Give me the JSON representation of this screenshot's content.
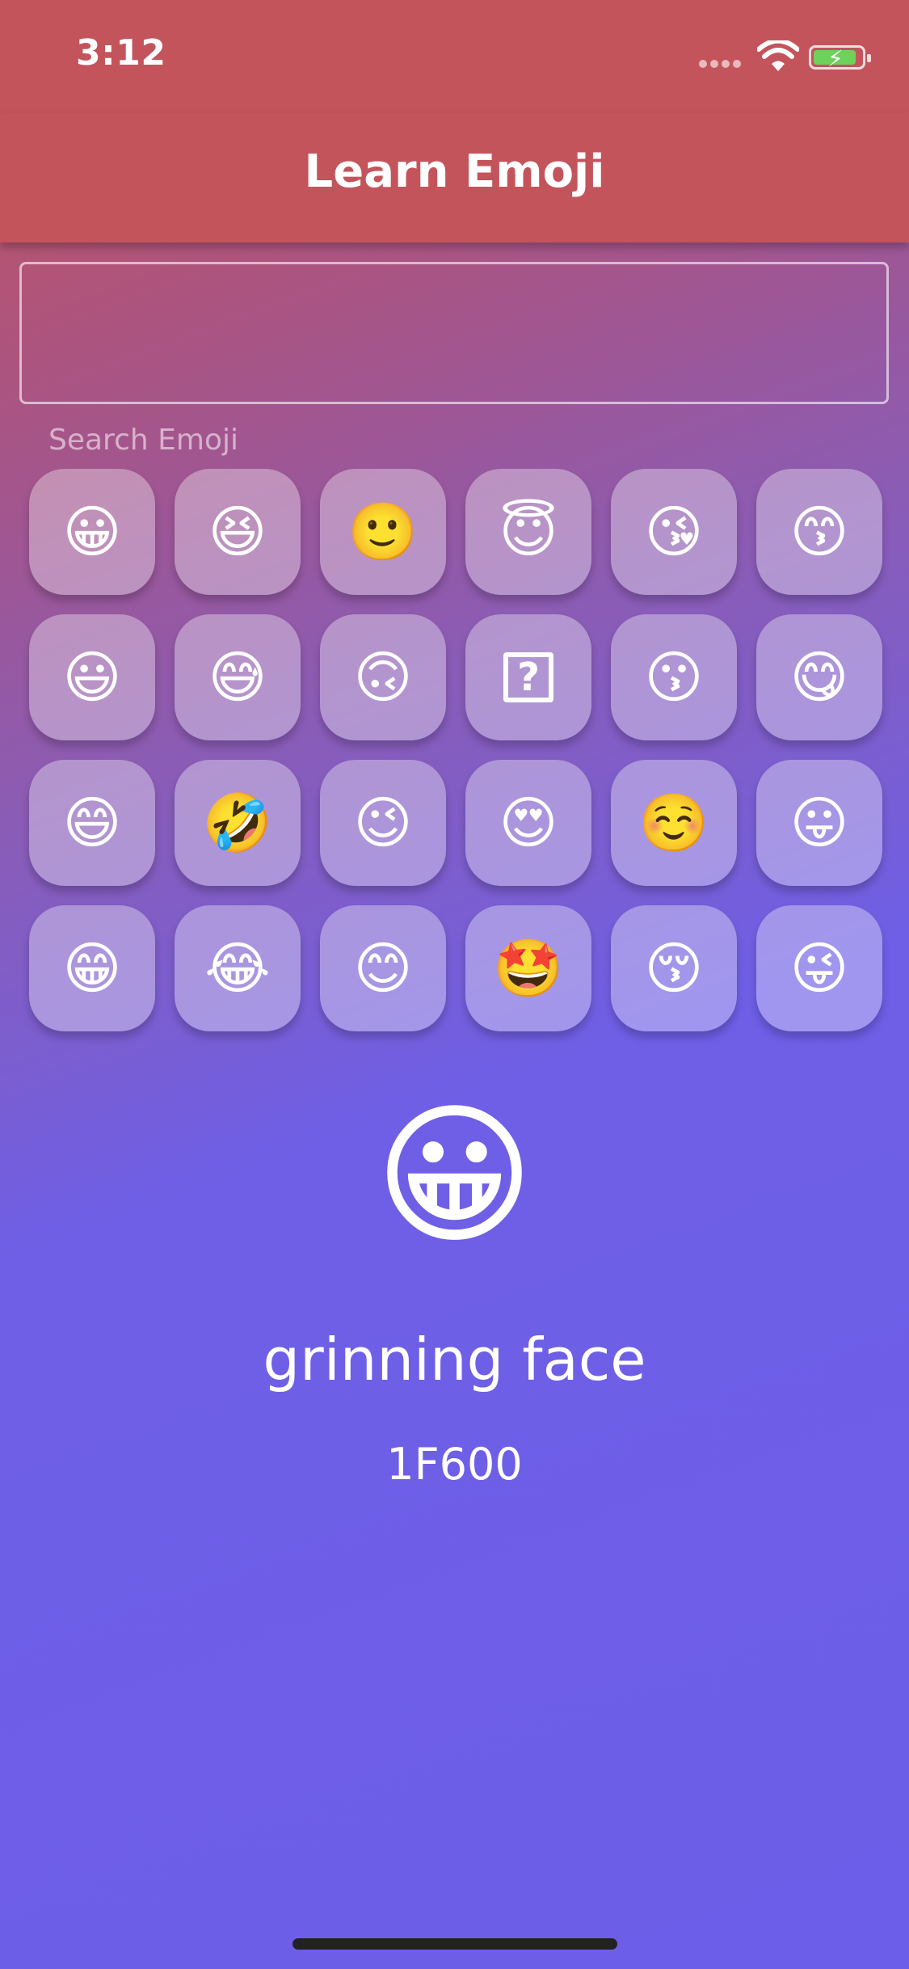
{
  "status_bar": {
    "time": "3:12",
    "icons": [
      "signal-dots-icon",
      "wifi-icon",
      "battery-charging-icon"
    ]
  },
  "nav": {
    "title": "Learn Emoji"
  },
  "search": {
    "value": "",
    "label": "Search Emoji"
  },
  "grid": {
    "items": [
      {
        "glyph": "😀",
        "name": "emoji-grinning-face"
      },
      {
        "glyph": "😆",
        "name": "emoji-grinning-squinting-face"
      },
      {
        "glyph": "🙂",
        "name": "emoji-slightly-smiling-face"
      },
      {
        "glyph": "😇",
        "name": "emoji-smiling-face-with-halo"
      },
      {
        "glyph": "😘",
        "name": "emoji-face-blowing-a-kiss"
      },
      {
        "glyph": "😙",
        "name": "emoji-kissing-face-with-smiling-eyes"
      },
      {
        "glyph": "😃",
        "name": "emoji-grinning-face-with-big-eyes"
      },
      {
        "glyph": "😅",
        "name": "emoji-grinning-face-with-sweat"
      },
      {
        "glyph": "🙃",
        "name": "emoji-upside-down-face"
      },
      {
        "glyph": "?",
        "name": "emoji-unknown-placeholder"
      },
      {
        "glyph": "😗",
        "name": "emoji-kissing-face"
      },
      {
        "glyph": "😋",
        "name": "emoji-face-savoring-food"
      },
      {
        "glyph": "😄",
        "name": "emoji-grinning-face-with-smiling-eyes"
      },
      {
        "glyph": "🤣",
        "name": "emoji-rolling-on-the-floor-laughing"
      },
      {
        "glyph": "😉",
        "name": "emoji-winking-face"
      },
      {
        "glyph": "😍",
        "name": "emoji-smiling-face-with-heart-eyes"
      },
      {
        "glyph": "☺️",
        "name": "emoji-smiling-face"
      },
      {
        "glyph": "😛",
        "name": "emoji-face-with-tongue"
      },
      {
        "glyph": "😁",
        "name": "emoji-beaming-face-with-smiling-eyes"
      },
      {
        "glyph": "😂",
        "name": "emoji-face-with-tears-of-joy"
      },
      {
        "glyph": "😊",
        "name": "emoji-smiling-face-with-smiling-eyes"
      },
      {
        "glyph": "🤩",
        "name": "emoji-star-struck"
      },
      {
        "glyph": "😚",
        "name": "emoji-kissing-face-with-closed-eyes"
      },
      {
        "glyph": "😜",
        "name": "emoji-winking-face-with-tongue"
      }
    ]
  },
  "selected": {
    "glyph": "😀",
    "name": "grinning face",
    "code": "1F600"
  },
  "colors": {
    "bar": "#c4545b",
    "gradient_bottom": "#6d5ee9",
    "tile": "rgba(255,255,255,0.35)"
  }
}
